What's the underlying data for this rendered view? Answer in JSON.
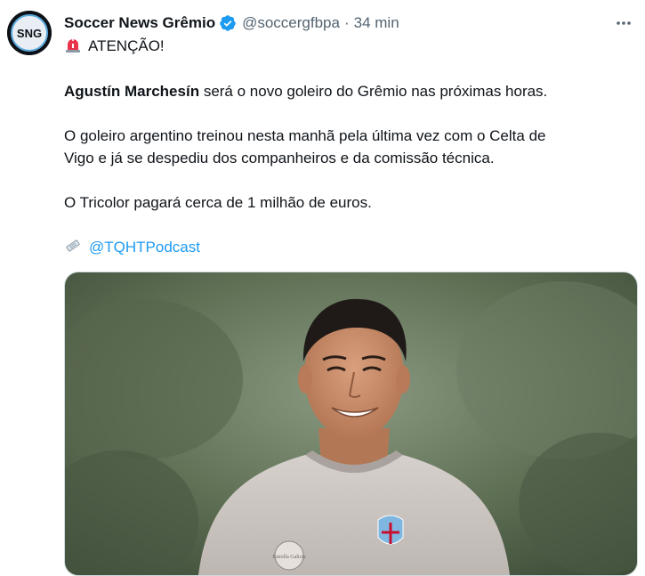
{
  "tweet": {
    "author_name": "Soccer News Grêmio",
    "author_handle": "@soccergfbpa",
    "separator": "·",
    "time": "34 min",
    "avatar_text": "SNG",
    "headline": "ATENÇÃO!",
    "para1_bold": "Agustín Marchesín",
    "para1_rest": " será o novo goleiro do Grêmio nas próximas horas.",
    "para2_line1": "O goleiro argentino treinou nesta manhã pela última vez com o Celta de",
    "para2_line2": "Vigo e já se despediu dos companheiros e da comissão técnica.",
    "para3": "O Tricolor pagará cerca de 1 milhão de euros.",
    "source_mention": "@TQHTPodcast",
    "jersey_sponsor": "Estrella Galicia"
  },
  "icons": {
    "verified": "verified-badge-icon",
    "more": "more-options-icon",
    "alert": "police-light-icon",
    "source": "newspaper-icon"
  },
  "colors": {
    "link": "#1d9bf0",
    "secondary_text": "#536471",
    "primary_text": "#0f1419"
  }
}
